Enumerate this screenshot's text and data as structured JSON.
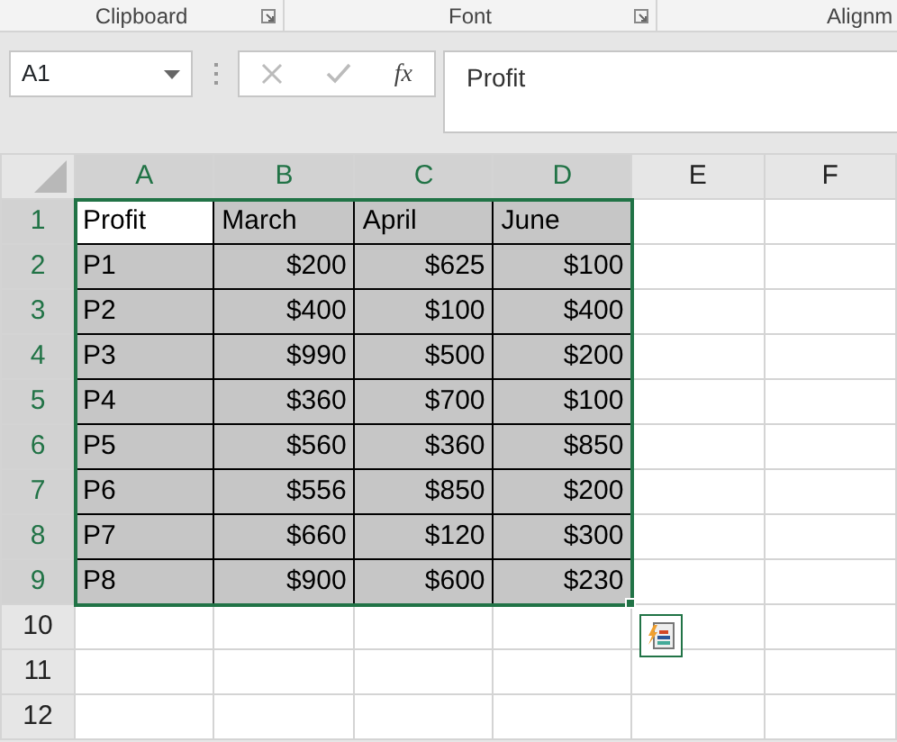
{
  "ribbon_groups": [
    {
      "label": "Clipboard",
      "launcher": true
    },
    {
      "label": "Font",
      "launcher": true
    },
    {
      "label": "Alignm",
      "launcher": false
    }
  ],
  "name_box": "A1",
  "formula_bar": {
    "function_label": "fx",
    "value": "Profit"
  },
  "columns": [
    {
      "label": "A",
      "selected": true
    },
    {
      "label": "B",
      "selected": true
    },
    {
      "label": "C",
      "selected": true
    },
    {
      "label": "D",
      "selected": true
    },
    {
      "label": "E",
      "selected": false
    },
    {
      "label": "F",
      "selected": false
    }
  ],
  "rows": [
    {
      "number": "1",
      "selected": true,
      "cells": [
        {
          "text": "Profit",
          "kind": "text",
          "active": true
        },
        {
          "text": "March",
          "kind": "text",
          "active": false
        },
        {
          "text": "April",
          "kind": "text",
          "active": false
        },
        {
          "text": "June",
          "kind": "text",
          "active": false
        }
      ]
    },
    {
      "number": "2",
      "selected": true,
      "cells": [
        {
          "text": "P1",
          "kind": "text",
          "active": false
        },
        {
          "text": "$200",
          "kind": "number",
          "active": false
        },
        {
          "text": "$625",
          "kind": "number",
          "active": false
        },
        {
          "text": "$100",
          "kind": "number",
          "active": false
        }
      ]
    },
    {
      "number": "3",
      "selected": true,
      "cells": [
        {
          "text": "P2",
          "kind": "text",
          "active": false
        },
        {
          "text": "$400",
          "kind": "number",
          "active": false
        },
        {
          "text": "$100",
          "kind": "number",
          "active": false
        },
        {
          "text": "$400",
          "kind": "number",
          "active": false
        }
      ]
    },
    {
      "number": "4",
      "selected": true,
      "cells": [
        {
          "text": "P3",
          "kind": "text",
          "active": false
        },
        {
          "text": "$990",
          "kind": "number",
          "active": false
        },
        {
          "text": "$500",
          "kind": "number",
          "active": false
        },
        {
          "text": "$200",
          "kind": "number",
          "active": false
        }
      ]
    },
    {
      "number": "5",
      "selected": true,
      "cells": [
        {
          "text": "P4",
          "kind": "text",
          "active": false
        },
        {
          "text": "$360",
          "kind": "number",
          "active": false
        },
        {
          "text": "$700",
          "kind": "number",
          "active": false
        },
        {
          "text": "$100",
          "kind": "number",
          "active": false
        }
      ]
    },
    {
      "number": "6",
      "selected": true,
      "cells": [
        {
          "text": "P5",
          "kind": "text",
          "active": false
        },
        {
          "text": "$560",
          "kind": "number",
          "active": false
        },
        {
          "text": "$360",
          "kind": "number",
          "active": false
        },
        {
          "text": "$850",
          "kind": "number",
          "active": false
        }
      ]
    },
    {
      "number": "7",
      "selected": true,
      "cells": [
        {
          "text": "P6",
          "kind": "text",
          "active": false
        },
        {
          "text": "$556",
          "kind": "number",
          "active": false
        },
        {
          "text": "$850",
          "kind": "number",
          "active": false
        },
        {
          "text": "$200",
          "kind": "number",
          "active": false
        }
      ]
    },
    {
      "number": "8",
      "selected": true,
      "cells": [
        {
          "text": "P7",
          "kind": "text",
          "active": false
        },
        {
          "text": "$660",
          "kind": "number",
          "active": false
        },
        {
          "text": "$120",
          "kind": "number",
          "active": false
        },
        {
          "text": "$300",
          "kind": "number",
          "active": false
        }
      ]
    },
    {
      "number": "9",
      "selected": true,
      "cells": [
        {
          "text": "P8",
          "kind": "text",
          "active": false
        },
        {
          "text": "$900",
          "kind": "number",
          "active": false
        },
        {
          "text": "$600",
          "kind": "number",
          "active": false
        },
        {
          "text": "$230",
          "kind": "number",
          "active": false
        }
      ]
    },
    {
      "number": "10",
      "selected": false,
      "cells": []
    },
    {
      "number": "11",
      "selected": false,
      "cells": []
    },
    {
      "number": "12",
      "selected": false,
      "cells": []
    }
  ]
}
